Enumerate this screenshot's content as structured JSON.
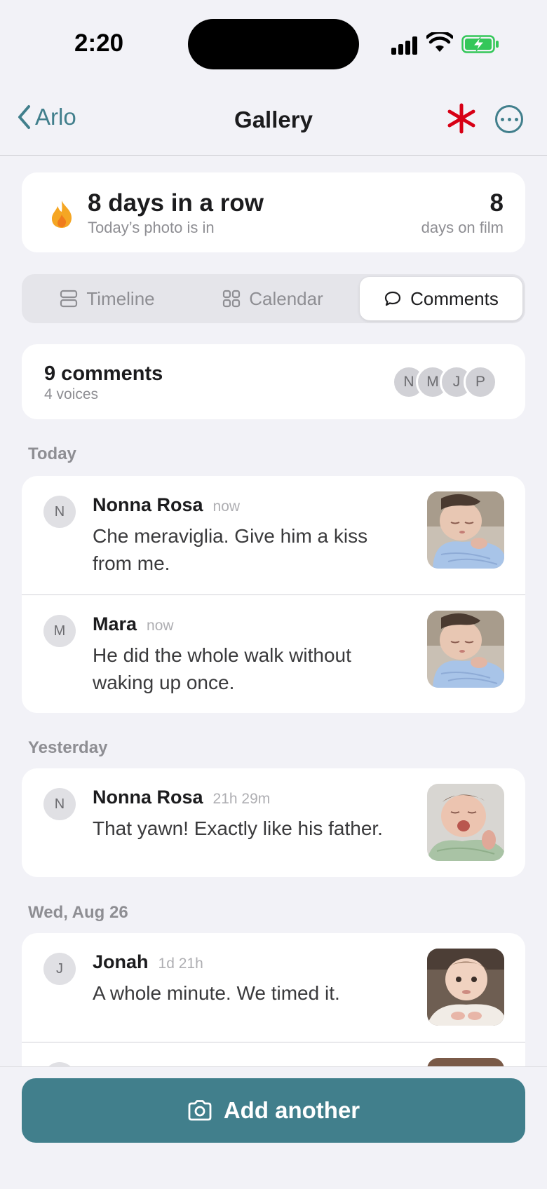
{
  "status_bar": {
    "time": "2:20"
  },
  "nav": {
    "back_label": "Arlo",
    "title": "Gallery"
  },
  "streak": {
    "title": "8 days in a row",
    "subtitle": "Today’s photo is in",
    "count": "8",
    "count_label": "days on film"
  },
  "tabs": [
    {
      "label": "Timeline",
      "icon": "timeline-icon",
      "selected": false
    },
    {
      "label": "Calendar",
      "icon": "grid-icon",
      "selected": false
    },
    {
      "label": "Comments",
      "icon": "speech-bubble-icon",
      "selected": true
    }
  ],
  "summary": {
    "title": "9 comments",
    "subtitle": "4 voices",
    "avatars": [
      "N",
      "M",
      "J",
      "P"
    ]
  },
  "sections": [
    {
      "header": "Today",
      "comments": [
        {
          "initial": "N",
          "name": "Nonna Rosa",
          "time": "now",
          "text": "Che meraviglia. Give him a kiss from me.",
          "thumb": "sleeping-baby-blue-blanket"
        },
        {
          "initial": "M",
          "name": "Mara",
          "time": "now",
          "text": "He did the whole walk without waking up once.",
          "thumb": "sleeping-baby-blue-blanket"
        }
      ]
    },
    {
      "header": "Yesterday",
      "comments": [
        {
          "initial": "N",
          "name": "Nonna Rosa",
          "time": "21h 29m",
          "text": "That yawn! Exactly like his father.",
          "thumb": "yawning-baby-green-swaddle"
        }
      ]
    },
    {
      "header": "Wed, Aug 26",
      "comments": [
        {
          "initial": "J",
          "name": "Jonah",
          "time": "1d 21h",
          "text": "A whole minute. We timed it.",
          "thumb": "baby-tummy-time"
        }
      ]
    }
  ],
  "bottom": {
    "button_label": "Add another"
  },
  "colors": {
    "accent": "#417f8c",
    "asterisk": "#d70015",
    "background": "#f2f2f7"
  }
}
